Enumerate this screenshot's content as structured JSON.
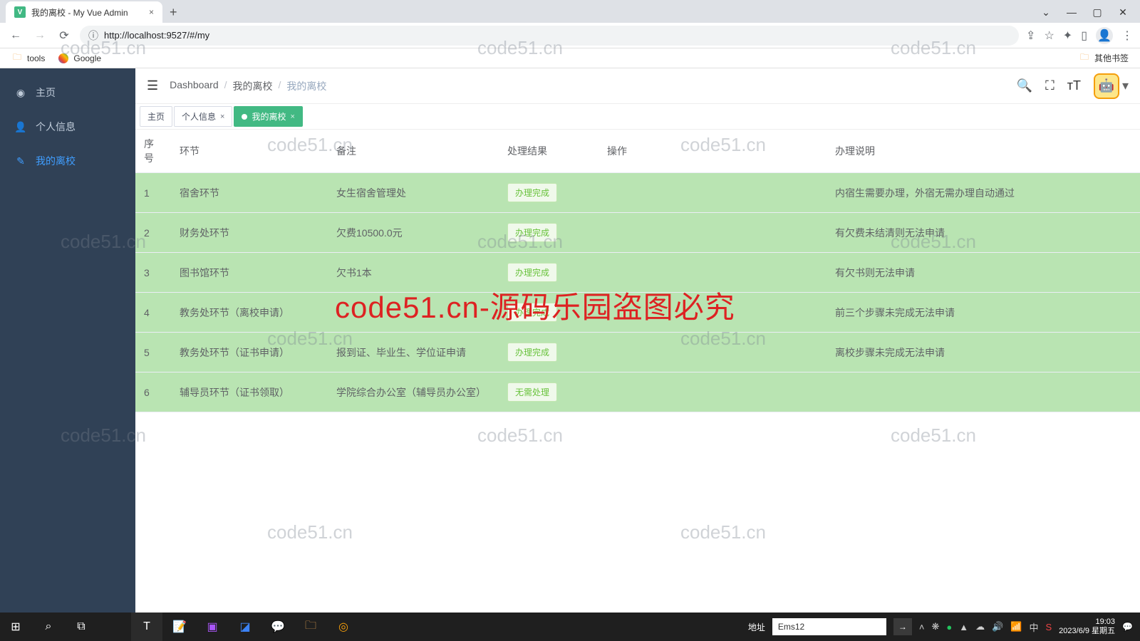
{
  "browser": {
    "tab_title": "我的离校 - My Vue Admin",
    "url": "http://localhost:9527/#/my",
    "bookmarks": {
      "tools": "tools",
      "google": "Google",
      "other": "其他书签"
    }
  },
  "sidebar": {
    "items": [
      {
        "icon": "dashboard",
        "label": "主页"
      },
      {
        "icon": "user",
        "label": "个人信息"
      },
      {
        "icon": "feather",
        "label": "我的离校"
      }
    ],
    "active_index": 2
  },
  "breadcrumb": {
    "items": [
      "Dashboard",
      "我的离校",
      "我的离校"
    ]
  },
  "view_tabs": [
    {
      "label": "主页",
      "active": false,
      "closable": false
    },
    {
      "label": "个人信息",
      "active": false,
      "closable": true
    },
    {
      "label": "我的离校",
      "active": true,
      "closable": true
    }
  ],
  "table": {
    "columns": {
      "seq": "序号",
      "step": "环节",
      "note": "备注",
      "result": "处理结果",
      "action": "操作",
      "desc": "办理说明"
    },
    "rows": [
      {
        "seq": "1",
        "step": "宿舍环节",
        "note": "女生宿舍管理处",
        "result": "办理完成",
        "action": "",
        "desc": "内宿生需要办理，外宿无需办理自动通过"
      },
      {
        "seq": "2",
        "step": "财务处环节",
        "note": "欠费10500.0元",
        "result": "办理完成",
        "action": "",
        "desc": "有欠费未结清则无法申请"
      },
      {
        "seq": "3",
        "step": "图书馆环节",
        "note": "欠书1本",
        "result": "办理完成",
        "action": "",
        "desc": "有欠书则无法申请"
      },
      {
        "seq": "4",
        "step": "教务处环节（离校申请）",
        "note": "",
        "result": "办理完成",
        "action": "",
        "desc": "前三个步骤未完成无法申请"
      },
      {
        "seq": "5",
        "step": "教务处环节（证书申请）",
        "note": "报到证、毕业生、学位证申请",
        "result": "办理完成",
        "action": "",
        "desc": "离校步骤未完成无法申请"
      },
      {
        "seq": "6",
        "step": "辅导员环节（证书领取）",
        "note": "学院综合办公室（辅导员办公室）",
        "result": "无需处理",
        "action": "",
        "desc": ""
      }
    ]
  },
  "taskbar": {
    "addr_label": "地址",
    "addr_value": "Ems12",
    "time": "19:03",
    "date": "2023/6/9 星期五"
  },
  "watermark": {
    "small": "code51.cn",
    "big": "code51.cn-源码乐园盗图必究"
  }
}
